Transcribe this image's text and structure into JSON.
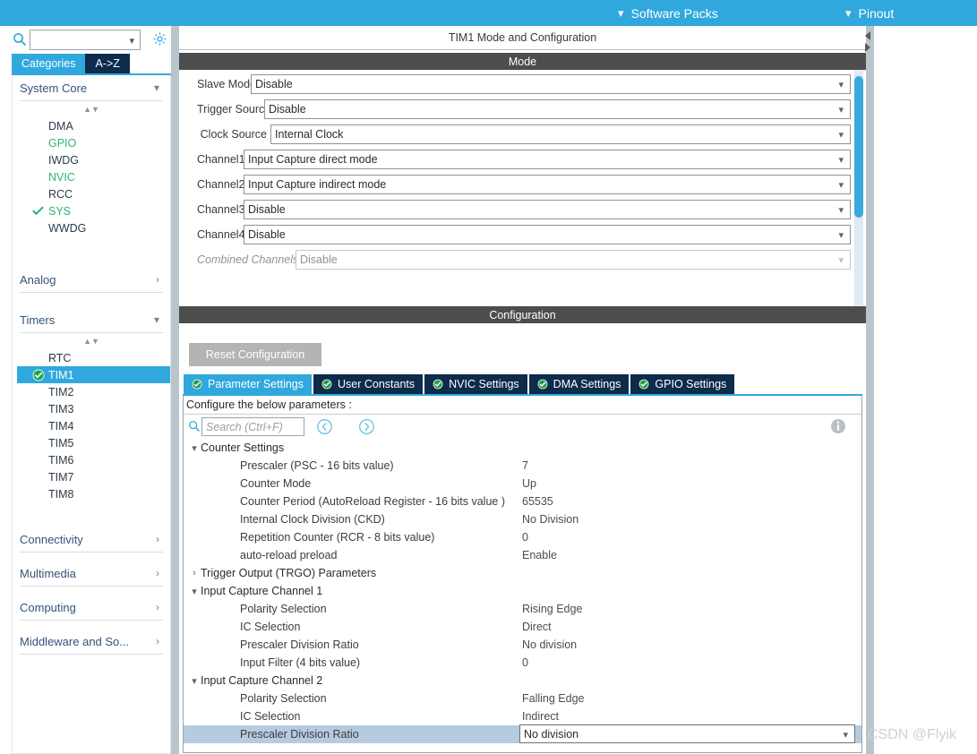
{
  "topbar": {
    "background": "#31a8dd",
    "items": [
      {
        "label": "Software Packs",
        "icon": "chevron-down-icon"
      },
      {
        "label": "Pinout",
        "icon": "chevron-down-icon"
      }
    ]
  },
  "sidebar": {
    "search": {
      "value": "",
      "placeholder": ""
    },
    "gear_icon": "gear-icon",
    "tabs": [
      {
        "label": "Categories",
        "active": true
      },
      {
        "label": "A->Z",
        "active": false
      }
    ],
    "groups": [
      {
        "label": "System Core",
        "expanded": true,
        "items": [
          {
            "label": "DMA",
            "state": "normal",
            "checked": false
          },
          {
            "label": "GPIO",
            "state": "configured",
            "checked": false
          },
          {
            "label": "IWDG",
            "state": "normal",
            "checked": false
          },
          {
            "label": "NVIC",
            "state": "configured",
            "checked": false
          },
          {
            "label": "RCC",
            "state": "normal",
            "checked": false
          },
          {
            "label": "SYS",
            "state": "configured",
            "checked": true
          },
          {
            "label": "WWDG",
            "state": "normal",
            "checked": false
          }
        ]
      },
      {
        "label": "Analog",
        "expanded": false,
        "items": []
      },
      {
        "label": "Timers",
        "expanded": true,
        "items": [
          {
            "label": "RTC",
            "state": "normal",
            "checked": false
          },
          {
            "label": "TIM1",
            "state": "selected",
            "checked": true
          },
          {
            "label": "TIM2",
            "state": "normal",
            "checked": false
          },
          {
            "label": "TIM3",
            "state": "normal",
            "checked": false
          },
          {
            "label": "TIM4",
            "state": "normal",
            "checked": false
          },
          {
            "label": "TIM5",
            "state": "normal",
            "checked": false
          },
          {
            "label": "TIM6",
            "state": "normal",
            "checked": false
          },
          {
            "label": "TIM7",
            "state": "normal",
            "checked": false
          },
          {
            "label": "TIM8",
            "state": "normal",
            "checked": false
          }
        ]
      },
      {
        "label": "Connectivity",
        "expanded": false,
        "items": []
      },
      {
        "label": "Multimedia",
        "expanded": false,
        "items": []
      },
      {
        "label": "Computing",
        "expanded": false,
        "items": []
      },
      {
        "label": "Middleware and So...",
        "expanded": false,
        "items": []
      }
    ]
  },
  "main": {
    "panel_title": "TIM1 Mode and Configuration",
    "mode_bar": "Mode",
    "configuration_bar": "Configuration",
    "mode_rows": [
      {
        "label": "Slave Mode",
        "value": "Disable",
        "label_w": 60,
        "disabled": false
      },
      {
        "label": "Trigger Source",
        "value": "Disable",
        "label_w": 75,
        "disabled": false
      },
      {
        "label": "Clock Source",
        "value": "Internal Clock",
        "label_w": 82,
        "disabled": false
      },
      {
        "label": "Channel1",
        "value": "Input Capture direct mode",
        "label_w": 45,
        "disabled": false
      },
      {
        "label": "Channel2",
        "value": "Input Capture indirect mode",
        "label_w": 45,
        "disabled": false
      },
      {
        "label": "Channel3",
        "value": "Disable",
        "label_w": 45,
        "disabled": false
      },
      {
        "label": "Channel4",
        "value": "Disable",
        "label_w": 45,
        "disabled": false
      },
      {
        "label": "Combined Channels",
        "value": "Disable",
        "label_w": 93,
        "disabled": true
      }
    ],
    "reset_button": "Reset Configuration",
    "conf_tabs": [
      {
        "label": "Parameter Settings",
        "active": true
      },
      {
        "label": "User Constants",
        "active": false
      },
      {
        "label": "NVIC Settings",
        "active": false
      },
      {
        "label": "DMA Settings",
        "active": false
      },
      {
        "label": "GPIO Settings",
        "active": false
      }
    ],
    "configure_text": "Configure the below parameters :",
    "param_search_placeholder": "Search (Ctrl+F)",
    "param_search_value": "",
    "prev_icon": "chevron-left-circle-icon",
    "next_icon": "chevron-right-circle-icon",
    "info_icon": "info-icon",
    "param_rows": [
      {
        "kind": "group",
        "expanded": true,
        "name": "Counter Settings"
      },
      {
        "kind": "param",
        "name": "Prescaler (PSC - 16 bits value)",
        "value": "7"
      },
      {
        "kind": "param",
        "name": "Counter Mode",
        "value": "Up"
      },
      {
        "kind": "param",
        "name": "Counter Period (AutoReload Register - 16 bits value )",
        "value": "65535"
      },
      {
        "kind": "param",
        "name": "Internal Clock Division (CKD)",
        "value": "No Division"
      },
      {
        "kind": "param",
        "name": "Repetition Counter (RCR - 8 bits value)",
        "value": "0"
      },
      {
        "kind": "param",
        "name": "auto-reload preload",
        "value": "Enable"
      },
      {
        "kind": "group",
        "expanded": false,
        "name": "Trigger Output (TRGO) Parameters"
      },
      {
        "kind": "group",
        "expanded": true,
        "name": "Input Capture Channel 1"
      },
      {
        "kind": "param",
        "name": "Polarity Selection",
        "value": "Rising Edge"
      },
      {
        "kind": "param",
        "name": "IC Selection",
        "value": "Direct"
      },
      {
        "kind": "param",
        "name": "Prescaler Division Ratio",
        "value": "No division"
      },
      {
        "kind": "param",
        "name": "Input Filter (4 bits value)",
        "value": "0"
      },
      {
        "kind": "group",
        "expanded": true,
        "name": "Input Capture Channel 2"
      },
      {
        "kind": "param",
        "name": "Polarity Selection",
        "value": "Falling Edge"
      },
      {
        "kind": "param",
        "name": "IC Selection",
        "value": "Indirect"
      },
      {
        "kind": "editing",
        "name": "Prescaler Division Ratio",
        "value": "No division"
      }
    ]
  },
  "watermark": "CSDN @Flyik",
  "colors": {
    "accent": "#31a8dd",
    "tab_dark": "#0d2b4a",
    "bar_dark": "#4d4d4d",
    "selected_row": "#b5cbe0",
    "configured_green": "#2bb673"
  }
}
